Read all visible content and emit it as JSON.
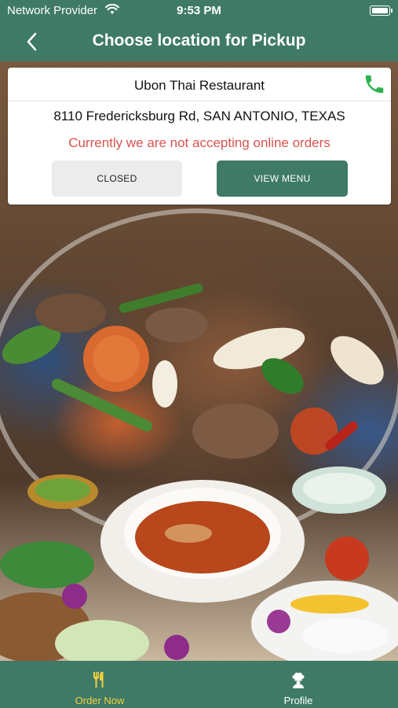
{
  "status_bar": {
    "carrier": "Network Provider",
    "time": "9:53 PM"
  },
  "nav": {
    "title": "Choose location for Pickup"
  },
  "restaurant": {
    "name": "Ubon Thai Restaurant",
    "address": "8110 Fredericksburg Rd, SAN ANTONIO, TEXAS",
    "notice": "Currently we are not accepting online orders",
    "closed_label": "CLOSED",
    "menu_label": "VIEW MENU"
  },
  "tabs": [
    {
      "label": "Order Now",
      "icon": "fork-knife-icon",
      "active": true
    },
    {
      "label": "Profile",
      "icon": "chef-icon",
      "active": false
    }
  ],
  "colors": {
    "brand": "#3f7a67",
    "notice": "#d9534f",
    "active_tab": "#f4d03f",
    "phone": "#2eb34f"
  }
}
